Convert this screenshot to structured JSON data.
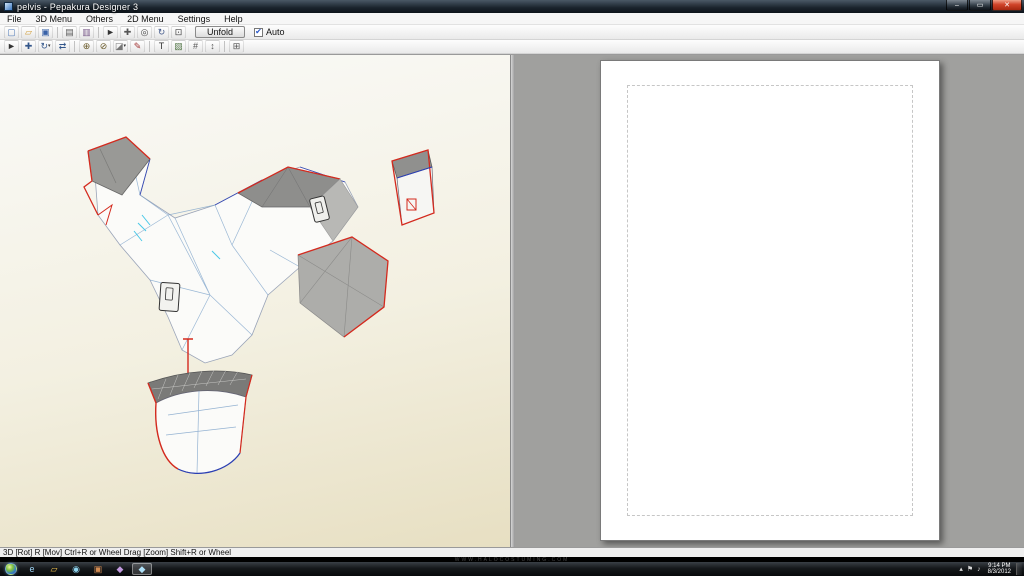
{
  "titlebar": {
    "title": "pelvis - Pepakura Designer 3",
    "minimize_glyph": "–",
    "maximize_glyph": "▭",
    "close_glyph": "✕"
  },
  "menubar": {
    "items": [
      "File",
      "3D Menu",
      "Others",
      "2D Menu",
      "Settings",
      "Help"
    ]
  },
  "toolbar_top": {
    "icons": [
      {
        "name": "new-file-icon",
        "glyph": "▢",
        "color": "#4f7ab8"
      },
      {
        "name": "open-file-icon",
        "glyph": "▱",
        "color": "#d09a32"
      },
      {
        "name": "save-file-icon",
        "glyph": "▣",
        "color": "#3962a8"
      },
      {
        "name": "separator",
        "glyph": "",
        "color": ""
      },
      {
        "name": "print-icon",
        "glyph": "▤",
        "color": "#5a5a5a"
      },
      {
        "name": "export-icon",
        "glyph": "▥",
        "color": "#7a5a8a"
      },
      {
        "name": "separator",
        "glyph": "",
        "color": ""
      },
      {
        "name": "select-tool-icon",
        "glyph": "►",
        "color": "#333333"
      },
      {
        "name": "pan-tool-icon",
        "glyph": "✚",
        "color": "#555555"
      },
      {
        "name": "zoom-tool-icon",
        "glyph": "◎",
        "color": "#444444"
      },
      {
        "name": "rotate-view-icon",
        "glyph": "↻",
        "color": "#445a8a"
      },
      {
        "name": "fit-view-icon",
        "glyph": "⊡",
        "color": "#444444"
      }
    ],
    "unfold_label": "Unfold",
    "auto_label": "Auto",
    "auto_checked": true,
    "check_glyph": "✔"
  },
  "toolbar_2d": {
    "icons": [
      {
        "name": "select-part-icon",
        "glyph": "►",
        "color": "#333333"
      },
      {
        "name": "move-part-icon",
        "glyph": "✚",
        "color": "#33568a"
      },
      {
        "name": "rotate-part-icon",
        "glyph": "↻",
        "color": "#33568a",
        "caret": true
      },
      {
        "name": "flip-part-icon",
        "glyph": "⇄",
        "color": "#33568a"
      },
      {
        "name": "separator",
        "glyph": "",
        "color": ""
      },
      {
        "name": "join-edges-icon",
        "glyph": "⊕",
        "color": "#6a5a2a"
      },
      {
        "name": "divide-face-icon",
        "glyph": "⊘",
        "color": "#6a5a2a"
      },
      {
        "name": "edit-flaps-icon",
        "glyph": "◪",
        "color": "#777777",
        "caret": true
      },
      {
        "name": "edge-color-icon",
        "glyph": "✎",
        "color": "#a03333"
      },
      {
        "name": "separator",
        "glyph": "",
        "color": ""
      },
      {
        "name": "add-text-icon",
        "glyph": "T",
        "color": "#333333"
      },
      {
        "name": "add-image-icon",
        "glyph": "▧",
        "color": "#55784a"
      },
      {
        "name": "measure-icon",
        "glyph": "#",
        "color": "#555555"
      },
      {
        "name": "scale-part-icon",
        "glyph": "↕",
        "color": "#555555"
      },
      {
        "name": "separator",
        "glyph": "",
        "color": ""
      },
      {
        "name": "grid-icon",
        "glyph": "⊞",
        "color": "#555555"
      }
    ]
  },
  "viewport3d": {
    "colors": {
      "cut_edge": "#d42a1e",
      "fold_edge": "#2b3fb4",
      "fold_soft": "#7aa0c8",
      "face_front": "#fbfbf9",
      "face_back": "#949494"
    }
  },
  "statusbar": {
    "text": "3D [Rot] R [Mov] Ctrl+R or Wheel Drag [Zoom] Shift+R or Wheel"
  },
  "watermark": {
    "text": "WWW.HALOCOSTUMING.COM"
  },
  "taskbar": {
    "apps": [
      {
        "name": "taskbar-app-internet-explorer",
        "glyph": "e",
        "color": "#9ed4f5"
      },
      {
        "name": "taskbar-app-file-explorer",
        "glyph": "▱",
        "color": "#f0c24e"
      },
      {
        "name": "taskbar-app-media-player",
        "glyph": "◉",
        "color": "#8fd4ef"
      },
      {
        "name": "taskbar-app-photo-viewer",
        "glyph": "▣",
        "color": "#d08a52"
      },
      {
        "name": "taskbar-app-pepakura-viewer",
        "glyph": "◆",
        "color": "#c39be0"
      },
      {
        "name": "taskbar-app-pepakura-designer",
        "glyph": "◆",
        "color": "#aee0f8",
        "active": true
      }
    ],
    "tray_icons": [
      {
        "name": "hidden-icons-arrow",
        "glyph": "▴"
      },
      {
        "name": "action-center-flag-icon",
        "glyph": "⚑"
      },
      {
        "name": "volume-icon",
        "glyph": "♪"
      }
    ],
    "clock": {
      "time": "9:14 PM",
      "date": "8/3/2012"
    }
  }
}
